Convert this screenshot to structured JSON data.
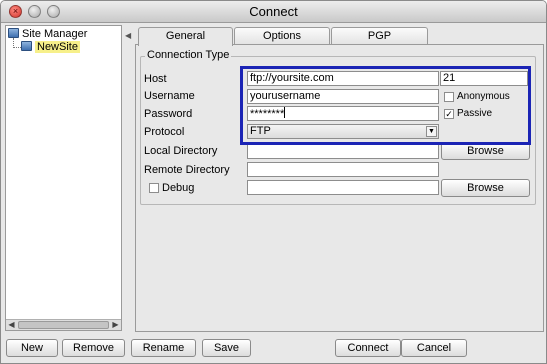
{
  "window": {
    "title": "Connect"
  },
  "tree": {
    "root_label": "Site Manager",
    "items": [
      {
        "label": "NewSite",
        "selected": true
      }
    ]
  },
  "tabs": [
    {
      "label": "General",
      "active": true
    },
    {
      "label": "Options",
      "active": false
    },
    {
      "label": "PGP",
      "active": false
    }
  ],
  "connection": {
    "group_title": "Connection Type",
    "host_label": "Host",
    "host_value": "ftp://yoursite.com",
    "port_value": "21",
    "username_label": "Username",
    "username_value": "yourusername",
    "anonymous_label": "Anonymous",
    "anonymous_checked": false,
    "password_label": "Password",
    "password_value": "********",
    "passive_label": "Passive",
    "passive_checked": true,
    "protocol_label": "Protocol",
    "protocol_value": "FTP",
    "local_dir_label": "Local Directory",
    "local_dir_value": "",
    "remote_dir_label": "Remote Directory",
    "remote_dir_value": "",
    "debug_label": "Debug",
    "debug_checked": false,
    "debug_value": "",
    "browse_label": "Browse"
  },
  "buttons": {
    "new": "New",
    "remove": "Remove",
    "rename": "Rename",
    "save": "Save",
    "connect": "Connect",
    "cancel": "Cancel"
  },
  "colors": {
    "highlight": "#1b24b5",
    "selection": "#f7f08a"
  }
}
